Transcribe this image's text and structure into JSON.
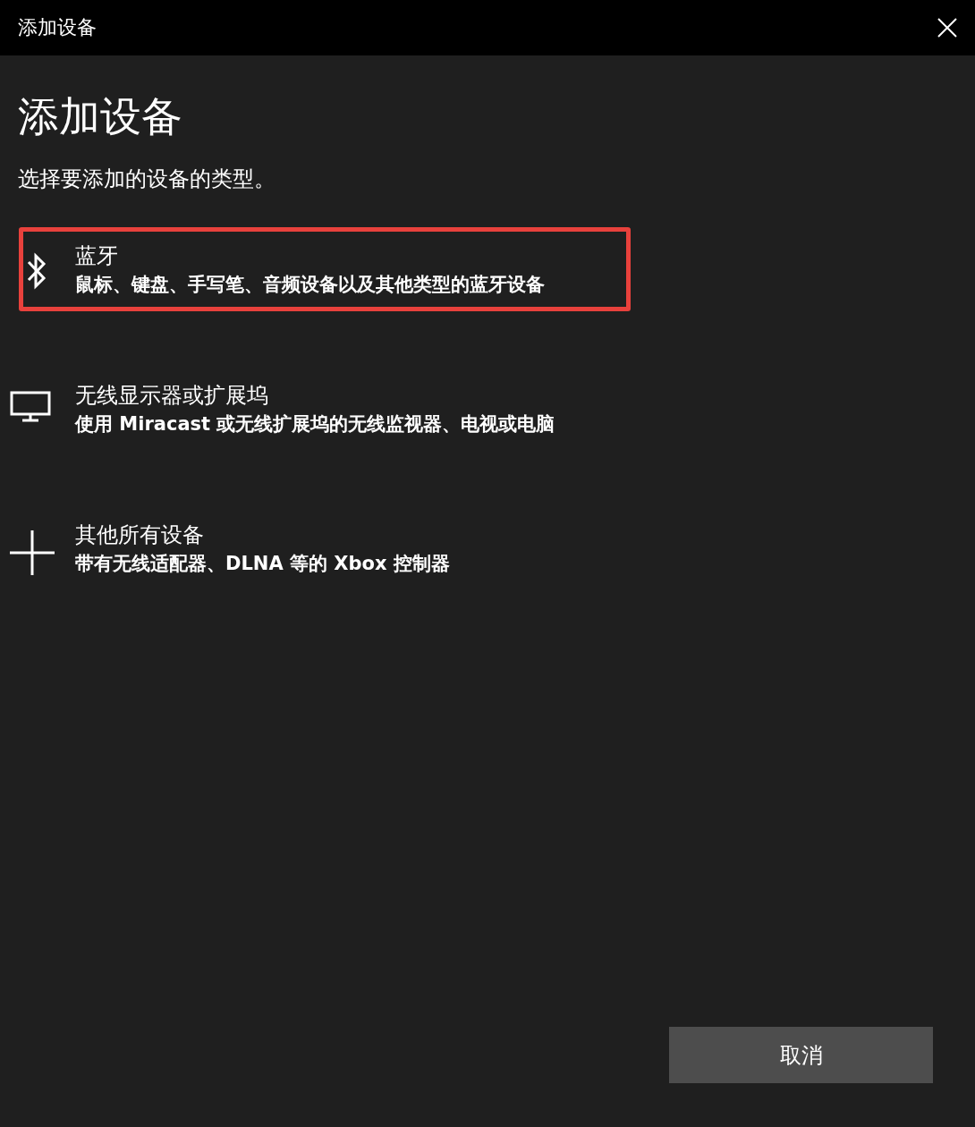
{
  "window": {
    "title": "添加设备"
  },
  "heading": "添加设备",
  "subtitle": "选择要添加的设备的类型。",
  "devices": [
    {
      "kind": "bluetooth",
      "title": "蓝牙",
      "description": "鼠标、键盘、手写笔、音频设备以及其他类型的蓝牙设备",
      "highlighted": true
    },
    {
      "kind": "display",
      "title": "无线显示器或扩展坞",
      "description": "使用 Miracast 或无线扩展坞的无线监视器、电视或电脑",
      "highlighted": false
    },
    {
      "kind": "other",
      "title": "其他所有设备",
      "description": "带有无线适配器、DLNA 等的 Xbox 控制器",
      "highlighted": false
    }
  ],
  "buttons": [
    {
      "label": "取消"
    }
  ]
}
